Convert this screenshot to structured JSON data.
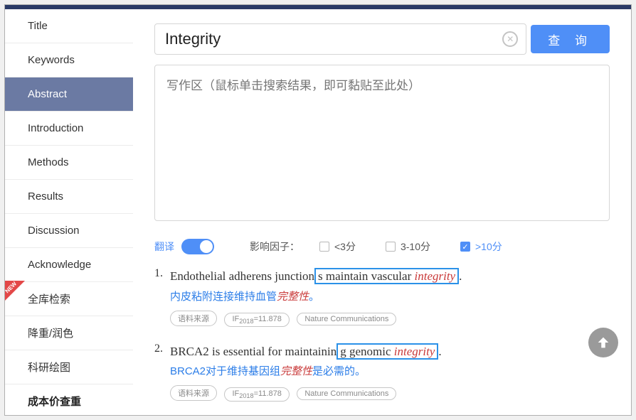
{
  "sidebar": {
    "items": [
      {
        "label": "Title"
      },
      {
        "label": "Keywords"
      },
      {
        "label": "Abstract"
      },
      {
        "label": "Introduction"
      },
      {
        "label": "Methods"
      },
      {
        "label": "Results"
      },
      {
        "label": "Discussion"
      },
      {
        "label": "Acknowledge"
      },
      {
        "label": "全库检索"
      },
      {
        "label": "降重/润色"
      },
      {
        "label": "科研绘图"
      },
      {
        "label": "成本价查重"
      }
    ],
    "new_badge": "NEW"
  },
  "search": {
    "value": "Integrity",
    "query_btn": "查 询"
  },
  "writearea": {
    "placeholder": "写作区（鼠标单击搜索结果，即可黏贴至此处）"
  },
  "filters": {
    "translate_label": "翻译",
    "if_label": "影响因子：",
    "opt1": "<3分",
    "opt2": "3-10分",
    "opt3": ">10分"
  },
  "results": [
    {
      "num": "1.",
      "pre": "Endothelial adherens junction",
      "box": "s maintain vascular ",
      "hi": "integrity",
      "post": ".",
      "trans_pre": "内皮粘附连接维持血管",
      "trans_hi": "完整性",
      "trans_post": "。",
      "tag_src": "语料来源",
      "tag_if_pre": "IF",
      "tag_if_year": "2018",
      "tag_if_val": "=11.878",
      "tag_journal": "Nature Communications"
    },
    {
      "num": "2.",
      "pre": "BRCA2 is essential for maintainin",
      "box": "g genomic ",
      "hi": "integrity",
      "post": ".",
      "trans_pre": "BRCA2对于维持基因组",
      "trans_hi": "完整性",
      "trans_post": "是必需的。",
      "tag_src": "语料来源",
      "tag_if_pre": "IF",
      "tag_if_year": "2018",
      "tag_if_val": "=11.878",
      "tag_journal": "Nature Communications"
    }
  ]
}
